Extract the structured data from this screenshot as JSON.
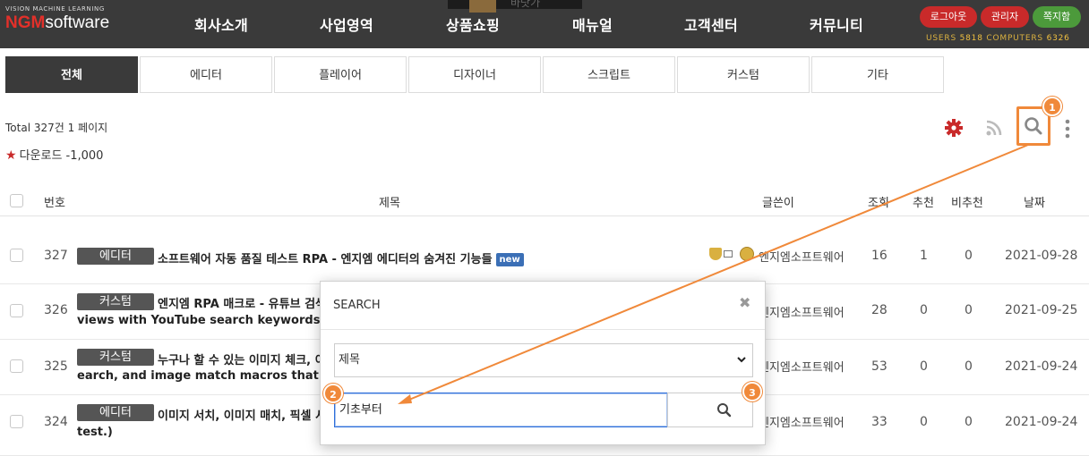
{
  "header": {
    "logo_tag": "VISION MACHINE LEARNING",
    "logo_ngm": "NGM",
    "logo_software": "software",
    "banner_text": "바닷가",
    "nav": [
      "회사소개",
      "사업영역",
      "상품쇼핑",
      "매뉴얼",
      "고객센터",
      "커뮤니티"
    ],
    "buttons": {
      "logout": "로그아웃",
      "admin": "관리자",
      "messages": "쪽지함"
    },
    "stats": {
      "users_label": "USERS",
      "users": "5818",
      "computers_label": "COMPUTERS",
      "computers": "6326"
    }
  },
  "tabs": [
    "전체",
    "에디터",
    "플레이어",
    "디자이너",
    "스크립트",
    "커스텀",
    "기타"
  ],
  "active_tab": "전체",
  "info": {
    "total": "Total 327건 1 페이지",
    "download": "다운로드 -1,000"
  },
  "tools": {
    "settings": "gear-icon",
    "rss": "rss-icon",
    "search": "search-icon",
    "more": "more-vertical-icon"
  },
  "table": {
    "columns": {
      "num": "번호",
      "title": "제목",
      "author": "글쓴이",
      "views": "조회",
      "rec": "추천",
      "nrec": "비추천",
      "date": "날짜"
    },
    "rows": [
      {
        "num": "327",
        "category": "에디터",
        "title": "소프트웨어 자동 품질 테스트 RPA - 엔지엠 에디터의 숨겨진 기능들",
        "title2": "",
        "new": "new",
        "author": "엔지엠소프트웨어",
        "views": "16",
        "rec": "1",
        "nrec": "0",
        "date": "2021-09-28"
      },
      {
        "num": "326",
        "category": "커스텀",
        "title": "엔지엠 RPA 매크로 - 유튜브 검색",
        "title2": "views with YouTube search keywords.)",
        "new": "",
        "author": "엔지엠소프트웨어",
        "views": "28",
        "rec": "0",
        "nrec": "0",
        "date": "2021-09-25"
      },
      {
        "num": "325",
        "category": "커스텀",
        "title": "누구나 할 수 있는 이미지 체크, 이",
        "title2": "earch, and image match macros that any",
        "new": "",
        "author": "엔지엠소프트웨어",
        "views": "53",
        "rec": "0",
        "nrec": "0",
        "date": "2021-09-24"
      },
      {
        "num": "324",
        "category": "에디터",
        "title": "이미지 서치, 이미지 매치, 픽셀 서",
        "title2": "test.)",
        "new": "",
        "author": "엔지엠소프트웨어",
        "views": "33",
        "rec": "0",
        "nrec": "0",
        "date": "2021-09-24"
      }
    ]
  },
  "modal": {
    "title": "SEARCH",
    "close": "✖",
    "field_selected": "제목",
    "query": "기초부터"
  },
  "annotations": {
    "badge1": "1",
    "badge2": "2",
    "badge3": "3",
    "color": "#f0893a"
  }
}
